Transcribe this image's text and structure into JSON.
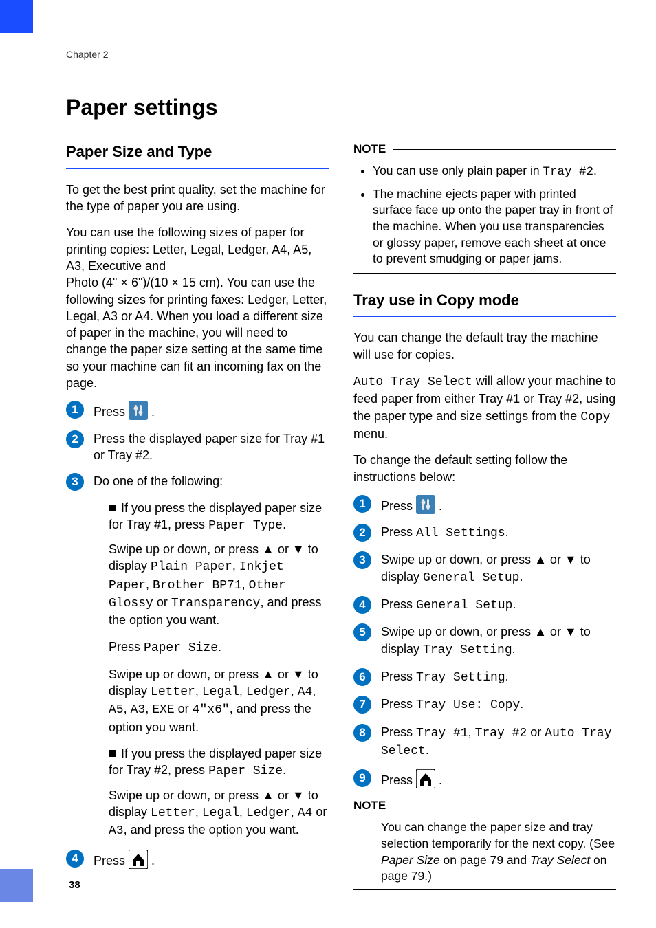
{
  "chapter": "Chapter 2",
  "page_number": "38",
  "h1": "Paper settings",
  "left": {
    "h2": "Paper Size and Type",
    "intro1": "To get the best print quality, set the machine for the type of paper you are using.",
    "intro2a": "You can use the following sizes of paper for printing copies: Letter, Legal, Ledger, A4, A5, A3, Executive and",
    "intro2b": "Photo (4\" × 6\")/(10 × 15 cm). You can use the following sizes for printing faxes: Ledger, Letter, Legal, A3 or A4. When you load a different size of paper in the machine, you will need to change the paper size setting at the same time so your machine can fit an incoming fax on the page.",
    "s1_a": "Press ",
    "s1_b": ".",
    "s2": "Press the displayed paper size for Tray #1 or Tray #2.",
    "s3": "Do one of the following:",
    "s3_b1a": "If you press the displayed paper size for Tray #1, press ",
    "s3_b1a_m": "Paper Type",
    "s3_b1a_end": ".",
    "s3_b1b_a": "Swipe up or down, or press ▲ or ▼ to display ",
    "s3_b1b_m1": "Plain Paper",
    "s3_b1b_mid1": ", ",
    "s3_b1b_m2": "Inkjet Paper",
    "s3_b1b_mid2": ", ",
    "s3_b1b_m3": "Brother BP71",
    "s3_b1b_mid3": ", ",
    "s3_b1b_m4": "Other Glossy",
    "s3_b1b_mid4": " or ",
    "s3_b1b_m5": "Transparency",
    "s3_b1b_end": ", and press the option you want.",
    "s3_b1c_a": "Press ",
    "s3_b1c_m": "Paper Size",
    "s3_b1c_end": ".",
    "s3_b1d_a": "Swipe up or down, or press ▲ or ▼ to display ",
    "s3_b1d_m1": "Letter",
    "s3_b1d_mid1": ", ",
    "s3_b1d_m2": "Legal",
    "s3_b1d_mid2": ", ",
    "s3_b1d_m3": "Ledger",
    "s3_b1d_mid3": ", ",
    "s3_b1d_m4": "A4",
    "s3_b1d_mid4": ", ",
    "s3_b1d_m5": "A5",
    "s3_b1d_mid5": ", ",
    "s3_b1d_m6": "A3",
    "s3_b1d_mid6": ", ",
    "s3_b1d_m7": "EXE",
    "s3_b1d_mid7": " or ",
    "s3_b1d_m8": "4\"x6\"",
    "s3_b1d_end": ", and press the option you want.",
    "s3_b2a": "If you press the displayed paper size for Tray #2, press ",
    "s3_b2a_m": "Paper Size",
    "s3_b2a_end": ".",
    "s3_b2b_a": "Swipe up or down, or press ▲ or ▼ to display ",
    "s3_b2b_m1": "Letter",
    "s3_b2b_mid1": ", ",
    "s3_b2b_m2": "Legal",
    "s3_b2b_mid2": ", ",
    "s3_b2b_m3": "Ledger",
    "s3_b2b_mid3": ", ",
    "s3_b2b_m4": "A4",
    "s3_b2b_mid4": " or ",
    "s3_b2b_m5": "A3",
    "s3_b2b_end": ", and press the option you want.",
    "s4_a": "Press ",
    "s4_b": "."
  },
  "right": {
    "note_label": "NOTE",
    "note1_li1_a": "You can use only plain paper in ",
    "note1_li1_m": "Tray #2",
    "note1_li1_b": ".",
    "note1_li2": "The machine ejects paper with printed surface face up onto the paper tray in front of the machine. When you use transparencies or glossy paper, remove each sheet at once to prevent smudging or paper jams.",
    "h2": "Tray use in Copy mode",
    "intro1": "You can change the default tray the machine will use for copies.",
    "intro2_m": "Auto Tray Select",
    "intro2_rest": " will allow your machine to feed paper from either Tray #1 or Tray #2, using the paper type and size settings from the ",
    "intro2_m2": "Copy",
    "intro2_end": " menu.",
    "intro3": "To change the default setting follow the instructions below:",
    "s1_a": "Press ",
    "s1_b": ".",
    "s2_a": "Press ",
    "s2_m": "All Settings",
    "s2_b": ".",
    "s3_a": "Swipe up or down, or press ▲ or ▼ to display ",
    "s3_m": "General Setup",
    "s3_b": ".",
    "s4_a": "Press ",
    "s4_m": "General Setup",
    "s4_b": ".",
    "s5_a": "Swipe up or down, or press ▲ or ▼ to display ",
    "s5_m": "Tray Setting",
    "s5_b": ".",
    "s6_a": "Press ",
    "s6_m": "Tray Setting",
    "s6_b": ".",
    "s7_a": "Press ",
    "s7_m": "Tray Use: Copy",
    "s7_b": ".",
    "s8_a": "Press ",
    "s8_m1": "Tray #1",
    "s8_mid1": ", ",
    "s8_m2": "Tray #2",
    "s8_mid2": " or ",
    "s8_m3": "Auto Tray Select",
    "s8_b": ".",
    "s9_a": "Press ",
    "s9_b": ".",
    "note2_a": "You can change the paper size and tray selection temporarily for the next copy. (See ",
    "note2_i1": "Paper Size",
    "note2_mid1": " on page 79 and ",
    "note2_i2": "Tray Select",
    "note2_mid2": " on page 79.)"
  }
}
